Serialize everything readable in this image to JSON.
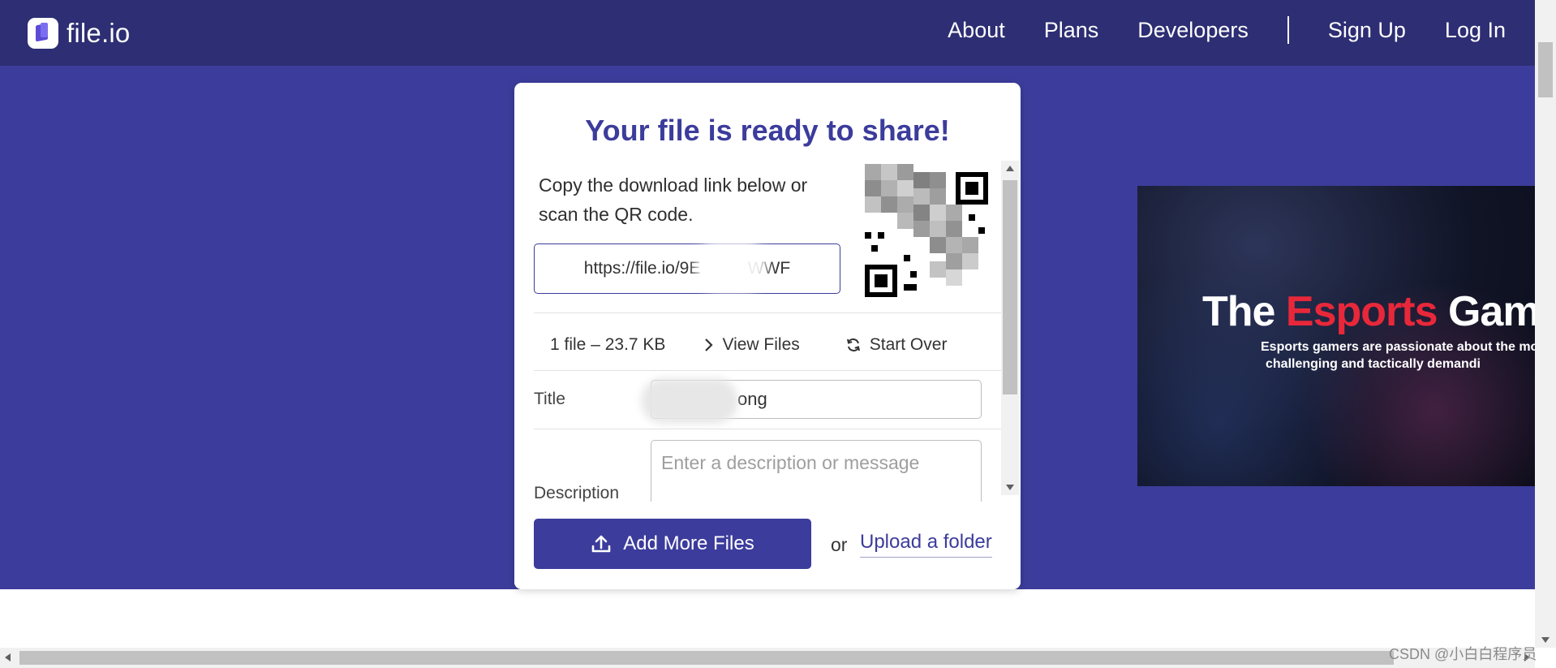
{
  "header": {
    "logo_text": "file.io",
    "nav": {
      "about": "About",
      "plans": "Plans",
      "developers": "Developers",
      "sign_up": "Sign Up",
      "log_in": "Log In"
    }
  },
  "card": {
    "title": "Your file is ready to share!",
    "instructions": "Copy the download link below or scan the QR code.",
    "link_value": "https://file.io/9E          WWF",
    "info": {
      "file_count": "1 file – 23.7 KB",
      "view_files": "View Files",
      "start_over": "Start Over"
    },
    "form": {
      "title_label": "Title",
      "title_value": "ong",
      "description_label": "Description",
      "description_placeholder": "Enter a description or message"
    },
    "actions": {
      "add_more": "Add More Files",
      "or": "or",
      "upload_folder": "Upload a folder"
    }
  },
  "ad": {
    "headline_before": "The ",
    "headline_accent": "Esports",
    "headline_after": " Gam",
    "subline_1": "Esports gamers are passionate about the mos",
    "subline_2": "challenging and tactically demandi"
  },
  "watermark": "CSDN @小白白程序员",
  "colors": {
    "header_bg": "#2d2e73",
    "band_bg": "#3c3c9c",
    "accent": "#3c3c9c",
    "ad_accent": "#e8283a"
  }
}
